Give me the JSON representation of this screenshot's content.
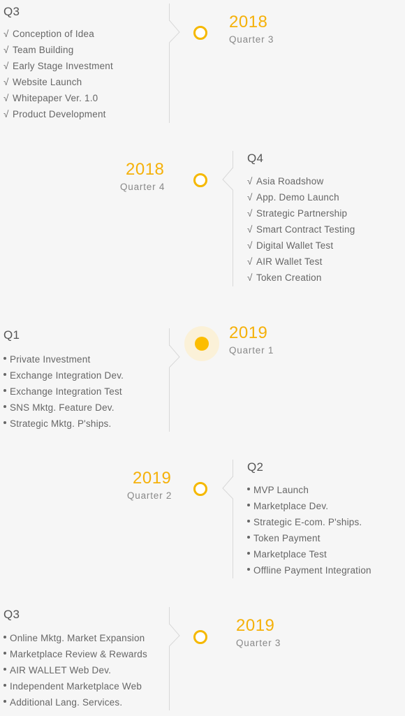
{
  "colors": {
    "accent": "#f5b10a",
    "node_border": "#f5b800",
    "active_fill": "#fcbd00",
    "halo": "#fbf1d8",
    "line": "#d8d8d8",
    "background": "#f6f6f6"
  },
  "milestones": [
    {
      "year": "2018",
      "quarter": "Quarter 3",
      "title": "Q3",
      "side": "left",
      "status": "done",
      "marker": "check",
      "items": [
        "Conception of Idea",
        "Team Building",
        "Early Stage Investment",
        "Website Launch",
        "Whitepaper Ver. 1.0",
        "Product Development"
      ]
    },
    {
      "year": "2018",
      "quarter": "Quarter 4",
      "title": "Q4",
      "side": "right",
      "status": "done",
      "marker": "check",
      "items": [
        "Asia Roadshow",
        "App. Demo Launch",
        "Strategic Partnership",
        "Smart Contract Testing",
        "Digital Wallet Test",
        "AIR Wallet Test",
        "Token Creation"
      ]
    },
    {
      "year": "2019",
      "quarter": "Quarter 1",
      "title": "Q1",
      "side": "left",
      "status": "current",
      "marker": "bullet",
      "items": [
        "Private Investment",
        "Exchange Integration Dev.",
        "Exchange Integration Test",
        "SNS Mktg. Feature Dev.",
        "Strategic Mktg. P'ships."
      ]
    },
    {
      "year": "2019",
      "quarter": "Quarter 2",
      "title": "Q2",
      "side": "right",
      "status": "upcoming",
      "marker": "bullet",
      "items": [
        "MVP Launch",
        "Marketplace Dev.",
        "Strategic E-com. P'ships.",
        "Token Payment",
        "Marketplace Test",
        "Offline Payment Integration"
      ]
    },
    {
      "year": "2019",
      "quarter": "Quarter 3",
      "title": "Q3",
      "side": "left",
      "status": "upcoming",
      "marker": "bullet",
      "items": [
        "Online Mktg. Market Expansion",
        "Marketplace Review & Rewards",
        "AIR WALLET Web Dev.",
        "Independent Marketplace Web",
        "Additional Lang. Services."
      ]
    }
  ],
  "check_glyph": "√"
}
